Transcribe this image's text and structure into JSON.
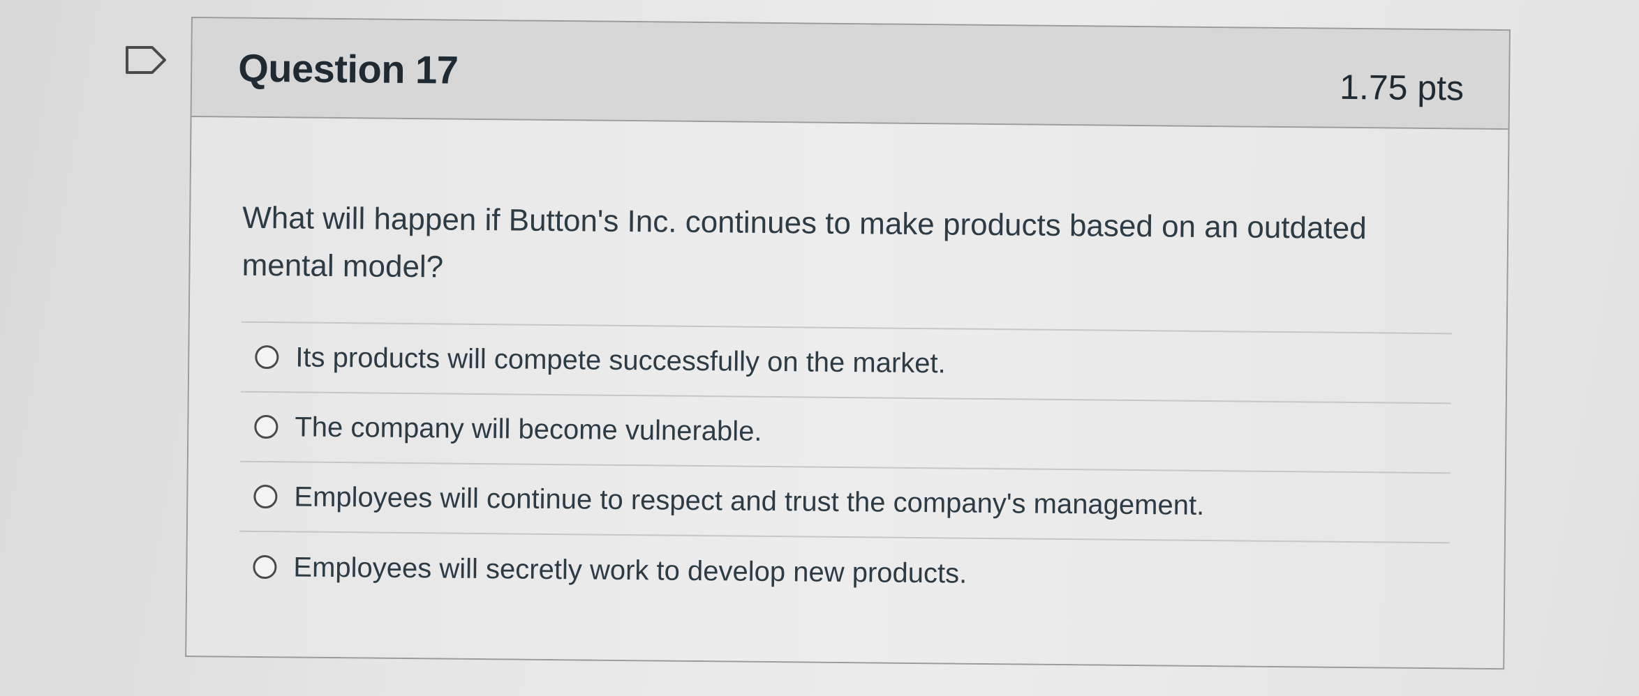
{
  "question": {
    "title": "Question 17",
    "points": "1.75 pts",
    "text": "What will happen if Button's Inc. continues to make products based on an outdated mental model?",
    "answers": [
      {
        "label": "Its products will compete successfully on the market.",
        "selected": false
      },
      {
        "label": "The company will become vulnerable.",
        "selected": false
      },
      {
        "label": "Employees will continue to respect and trust the company's management.",
        "selected": false
      },
      {
        "label": "Employees will secretly work to develop new products.",
        "selected": false
      }
    ]
  },
  "icons": {
    "flag": "flag-question-icon",
    "radio": "radio-unselected-icon"
  },
  "colors": {
    "text": "#2d3b45",
    "border": "#9a9a9a",
    "header_background": "#d7d7d7"
  }
}
